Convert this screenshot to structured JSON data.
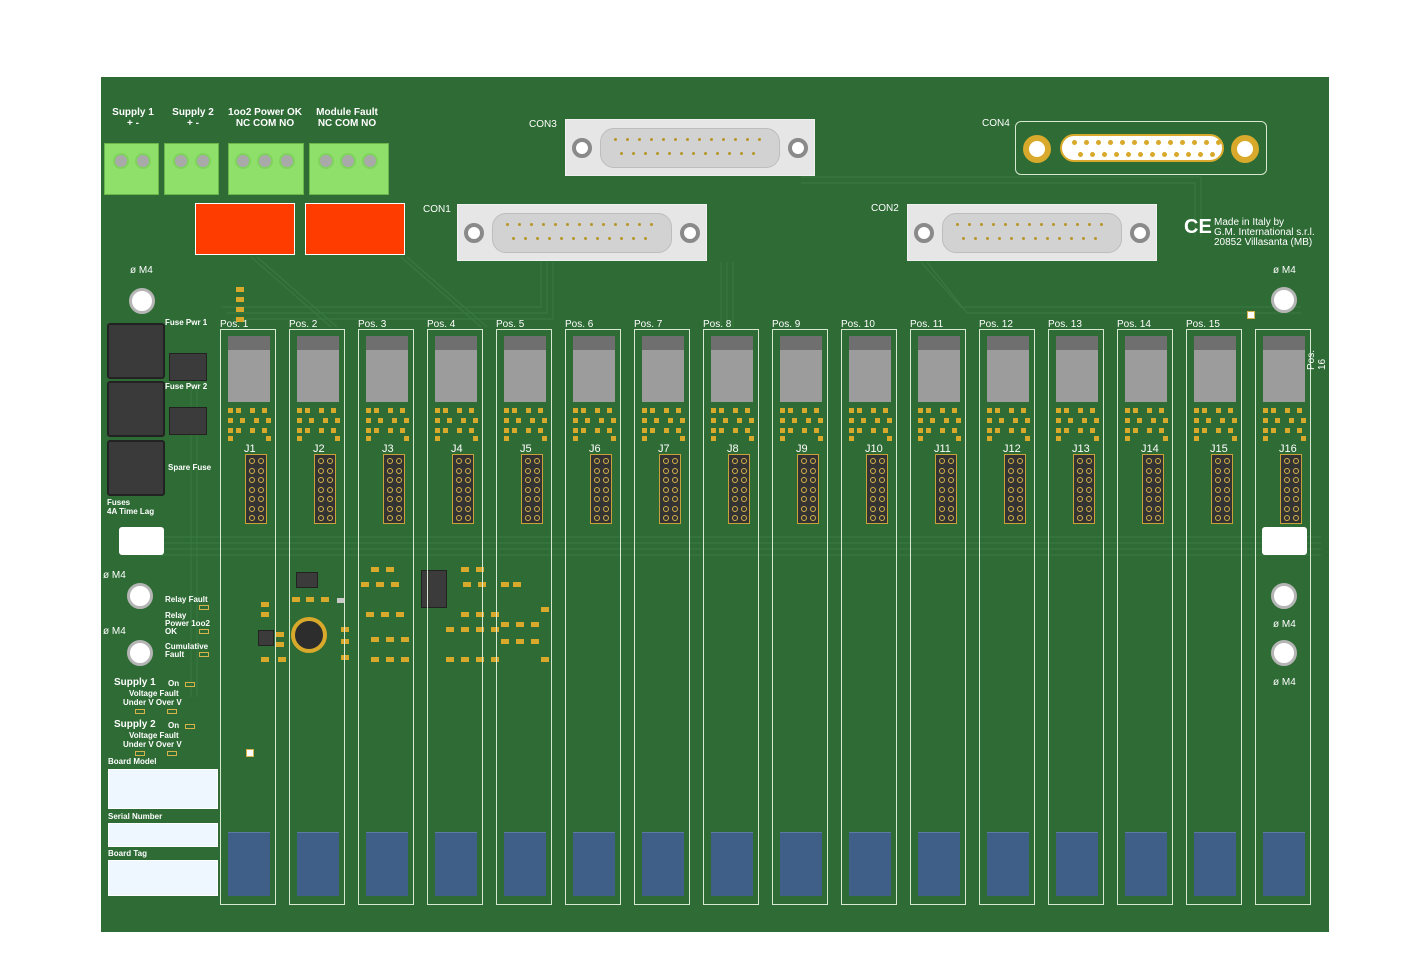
{
  "connectors": {
    "supply1": {
      "title": "Supply 1",
      "pins": "+     -"
    },
    "supply2": {
      "title": "Supply 2",
      "pins": "+     -"
    },
    "power_ok": {
      "title": "1oo2 Power OK",
      "pins": "NC COM NO"
    },
    "module_fault": {
      "title": "Module Fault",
      "pins": "NC COM NO"
    },
    "con1": "CON1",
    "con2": "CON2",
    "con3": "CON3",
    "con4": "CON4"
  },
  "maker": {
    "ce": "CE",
    "line1": "Made in Italy by",
    "line2": "G.M. International s.r.l.",
    "line3": "20852 Villasanta (MB)"
  },
  "holes": {
    "label": "ø M4"
  },
  "fuses": {
    "fuse_pwr1": "Fuse Pwr 1",
    "fuse_pwr2": "Fuse Pwr 2",
    "spare": "Spare Fuse",
    "title1": "Fuses",
    "title2": "4A Time Lag"
  },
  "status": {
    "relay_fault": "Relay Fault",
    "relay_power_1": "Relay",
    "relay_power_2": "Power 1oo2",
    "relay_power_3": "OK",
    "cumulative_1": "Cumulative",
    "cumulative_2": "Fault"
  },
  "supply_leds": {
    "s1": "Supply 1",
    "s2": "Supply 2",
    "on": "On",
    "vfault": "Voltage Fault",
    "uv_ov": "Under V  Over V"
  },
  "labels": {
    "board_model": "Board Model",
    "serial_number": "Serial Number",
    "board_tag": "Board Tag"
  },
  "positions": [
    "Pos. 1",
    "Pos. 2",
    "Pos. 3",
    "Pos. 4",
    "Pos. 5",
    "Pos. 6",
    "Pos. 7",
    "Pos. 8",
    "Pos. 9",
    "Pos. 10",
    "Pos. 11",
    "Pos. 12",
    "Pos. 13",
    "Pos. 14",
    "Pos. 15",
    "Pos. 16"
  ],
  "jacks": [
    "J1",
    "J2",
    "J3",
    "J4",
    "J5",
    "J6",
    "J7",
    "J8",
    "J9",
    "J10",
    "J11",
    "J12",
    "J13",
    "J14",
    "J15",
    "J16"
  ],
  "colors": {
    "board": "#2e6b35",
    "terminal": "#8ee06a",
    "relay_block": "#ff3c00",
    "capacitor": "#3f5f88"
  }
}
